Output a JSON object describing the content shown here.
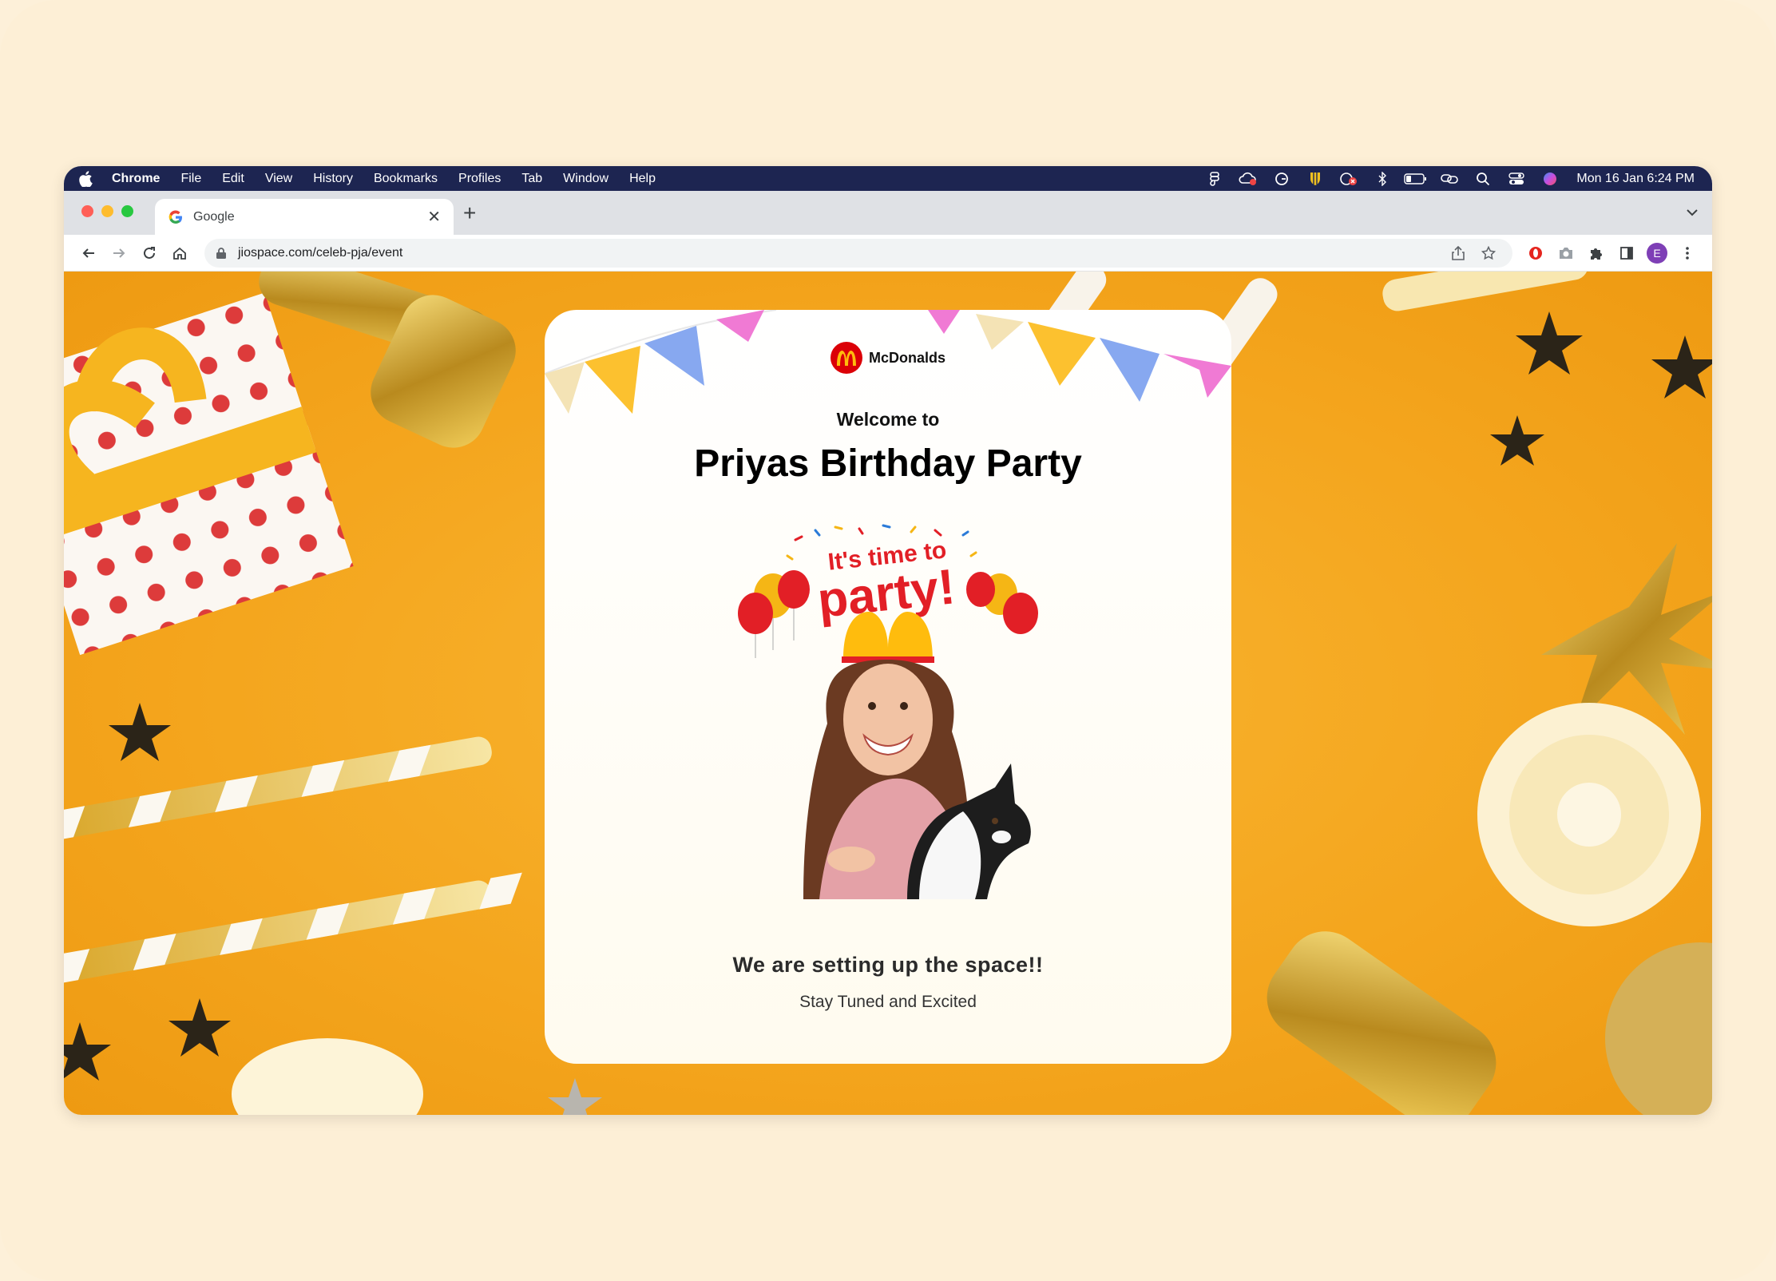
{
  "menubar": {
    "app_name": "Chrome",
    "items": [
      "File",
      "Edit",
      "View",
      "History",
      "Bookmarks",
      "Profiles",
      "Tab",
      "Window",
      "Help"
    ],
    "clock": "Mon 16 Jan  6:24 PM"
  },
  "tab": {
    "title": "Google",
    "new_tab_symbol": "+",
    "close_symbol": "✕"
  },
  "toolbar": {
    "url": "jiospace.com/celeb-pja/event",
    "profile_initial": "E"
  },
  "card": {
    "brand_name": "McDonalds",
    "welcome": "Welcome to",
    "event_title": "Priyas Birthday Party",
    "illustration_text_line1": "It's time to",
    "illustration_text_line2": "party!",
    "message_title": "We are setting up the space!!",
    "message_subtitle": "Stay Tuned and Excited"
  },
  "colors": {
    "menubar_bg": "#1d2551",
    "page_bg": "#f4a51d",
    "brand_red": "#db0007",
    "brand_yellow": "#ffbc0d",
    "avatar_purple": "#7e3fb6"
  }
}
